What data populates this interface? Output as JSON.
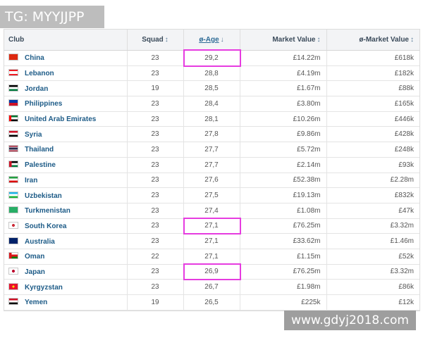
{
  "watermarks": {
    "top": "TG: MYYJJPP",
    "bottom": "www.gdyj2018.com"
  },
  "columns": {
    "club": "Club",
    "squad": "Squad",
    "age": "ø-Age",
    "market_value": "Market Value",
    "avg_market_value": "ø-Market Value"
  },
  "rows": [
    {
      "club": "China",
      "squad": "23",
      "age": "29,2",
      "mv": "£14.22m",
      "avg": "£618k",
      "highlighted": true,
      "flag": "linear-gradient(#de2910,#de2910)"
    },
    {
      "club": "Lebanon",
      "squad": "23",
      "age": "28,8",
      "mv": "£4.19m",
      "avg": "£182k",
      "highlighted": false,
      "flag": "linear-gradient(#ed1c24 0 25%,#fff 25% 75%,#ed1c24 75%)"
    },
    {
      "club": "Jordan",
      "squad": "19",
      "age": "28,5",
      "mv": "£1.67m",
      "avg": "£88k",
      "highlighted": false,
      "flag": "linear-gradient(#000 0 33%,#fff 33% 66%,#007a3d 66%)"
    },
    {
      "club": "Philippines",
      "squad": "23",
      "age": "28,4",
      "mv": "£3.80m",
      "avg": "£165k",
      "highlighted": false,
      "flag": "linear-gradient(#0038a8 0 50%,#ce1126 50%)"
    },
    {
      "club": "United Arab Emirates",
      "squad": "23",
      "age": "28,1",
      "mv": "£10.26m",
      "avg": "£446k",
      "highlighted": false,
      "flag": "linear-gradient(90deg,#ff0000 0 25%,transparent 25%),linear-gradient(#00732f 0 33%,#fff 33% 66%,#000 66%)"
    },
    {
      "club": "Syria",
      "squad": "23",
      "age": "27,8",
      "mv": "£9.86m",
      "avg": "£428k",
      "highlighted": false,
      "flag": "linear-gradient(#ce1126 0 33%,#fff 33% 66%,#000 66%)"
    },
    {
      "club": "Thailand",
      "squad": "23",
      "age": "27,7",
      "mv": "£5.72m",
      "avg": "£248k",
      "highlighted": false,
      "flag": "linear-gradient(#a51931 0 17%,#f4f5f8 17% 33%,#2d2a4a 33% 67%,#f4f5f8 67% 83%,#a51931 83%)"
    },
    {
      "club": "Palestine",
      "squad": "23",
      "age": "27,7",
      "mv": "£2.14m",
      "avg": "£93k",
      "highlighted": false,
      "flag": "linear-gradient(90deg,#ce1126 0 30%,transparent 30%),linear-gradient(#000 0 33%,#fff 33% 66%,#007a3d 66%)"
    },
    {
      "club": "Iran",
      "squad": "23",
      "age": "27,6",
      "mv": "£52.38m",
      "avg": "£2.28m",
      "highlighted": false,
      "flag": "linear-gradient(#239f40 0 33%,#fff 33% 66%,#da0000 66%)"
    },
    {
      "club": "Uzbekistan",
      "squad": "23",
      "age": "27,5",
      "mv": "£19.13m",
      "avg": "£832k",
      "highlighted": false,
      "flag": "linear-gradient(#1eb5e8 0 33%,#fff 33% 66%,#1eb53a 66%)"
    },
    {
      "club": "Turkmenistan",
      "squad": "23",
      "age": "27,4",
      "mv": "£1.08m",
      "avg": "£47k",
      "highlighted": false,
      "flag": "linear-gradient(#28ae66,#28ae66)"
    },
    {
      "club": "South Korea",
      "squad": "23",
      "age": "27,1",
      "mv": "£76.25m",
      "avg": "£3.32m",
      "highlighted": true,
      "flag": "radial-gradient(circle,#cd2e3a 0 28%,#ffffff 30%)"
    },
    {
      "club": "Australia",
      "squad": "23",
      "age": "27,1",
      "mv": "£33.62m",
      "avg": "£1.46m",
      "highlighted": false,
      "flag": "linear-gradient(#012169,#012169)"
    },
    {
      "club": "Oman",
      "squad": "22",
      "age": "27,1",
      "mv": "£1.15m",
      "avg": "£52k",
      "highlighted": false,
      "flag": "linear-gradient(90deg,#db161b 0 30%,transparent 30%),linear-gradient(#fff 0 33%,#db161b 33% 66%,#008000 66%)"
    },
    {
      "club": "Japan",
      "squad": "23",
      "age": "26,9",
      "mv": "£76.25m",
      "avg": "£3.32m",
      "highlighted": true,
      "flag": "radial-gradient(circle,#bc002d 0 28%,#ffffff 30%)"
    },
    {
      "club": "Kyrgyzstan",
      "squad": "23",
      "age": "26,7",
      "mv": "£1.98m",
      "avg": "£86k",
      "highlighted": false,
      "flag": "radial-gradient(circle,#ffd700 0 22%,#e8112d 24%)"
    },
    {
      "club": "Yemen",
      "squad": "19",
      "age": "26,5",
      "mv": "£225k",
      "avg": "£12k",
      "highlighted": false,
      "flag": "linear-gradient(#ce1126 0 33%,#fff 33% 66%,#000 66%)"
    }
  ],
  "colors": {
    "highlight": "#e63ce0",
    "club_link": "#1d5b87"
  }
}
